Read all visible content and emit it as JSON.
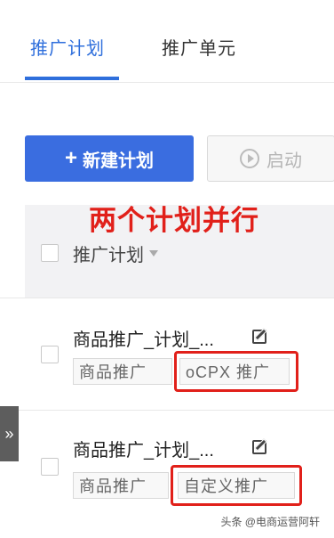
{
  "tabs": [
    {
      "label": "推广计划",
      "active": true
    },
    {
      "label": "推广单元",
      "active": false
    }
  ],
  "toolbar": {
    "new_plus": "+",
    "new_label": "新建计划",
    "start_label": "启动"
  },
  "annotation": "两个计划并行",
  "table": {
    "header_label": "推广计划"
  },
  "rows": [
    {
      "name": "商品推广_计划_...",
      "tags": [
        "商品推广",
        "oCPX 推广"
      ],
      "highlighted_tag": "oCPX 推广"
    },
    {
      "name": "商品推广_计划_...",
      "tags": [
        "商品推广",
        "自定义推广"
      ],
      "highlighted_tag": "自定义推广"
    }
  ],
  "side_toggle": "»",
  "watermark": "头条 @电商运营阿轩",
  "colors": {
    "accent": "#3a6de0",
    "annotation": "#e1201a"
  }
}
